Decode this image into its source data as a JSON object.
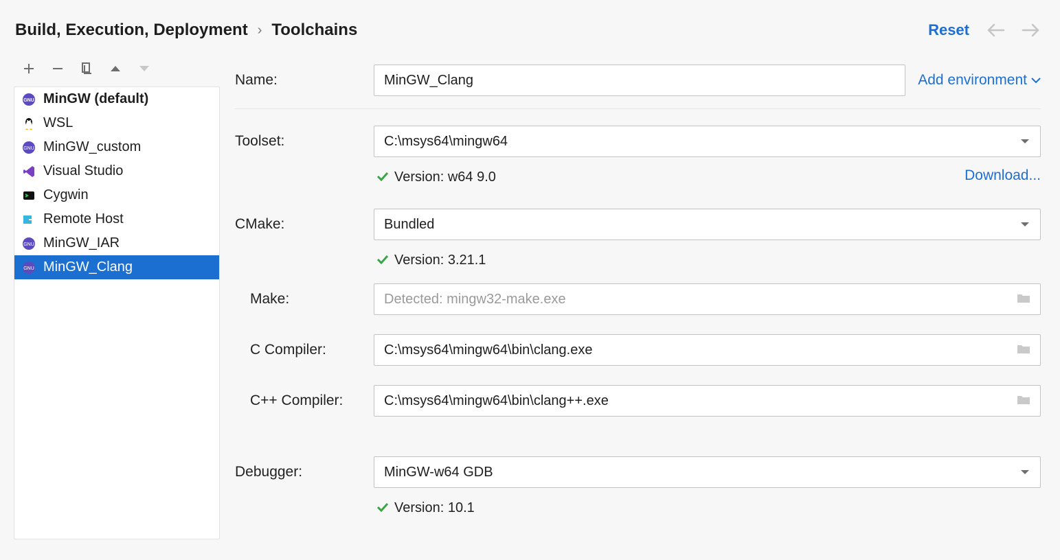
{
  "breadcrumb": {
    "parent": "Build, Execution, Deployment",
    "current": "Toolchains"
  },
  "header": {
    "reset": "Reset"
  },
  "sidebar": {
    "items": [
      {
        "label": "MinGW (default)",
        "icon": "gnu",
        "default": true
      },
      {
        "label": "WSL",
        "icon": "tux"
      },
      {
        "label": "MinGW_custom",
        "icon": "gnu"
      },
      {
        "label": "Visual Studio",
        "icon": "vs"
      },
      {
        "label": "Cygwin",
        "icon": "cygwin"
      },
      {
        "label": "Remote Host",
        "icon": "remote"
      },
      {
        "label": "MinGW_IAR",
        "icon": "gnu"
      },
      {
        "label": "MinGW_Clang",
        "icon": "gnu",
        "selected": true
      }
    ]
  },
  "details": {
    "name_label": "Name:",
    "name_value": "MinGW_Clang",
    "add_env": "Add environment",
    "toolset_label": "Toolset:",
    "toolset_value": "C:\\msys64\\mingw64",
    "toolset_version": "Version: w64 9.0",
    "download": "Download...",
    "cmake_label": "CMake:",
    "cmake_value": "Bundled",
    "cmake_version": "Version: 3.21.1",
    "make_label": "Make:",
    "make_placeholder": "Detected: mingw32-make.exe",
    "ccomp_label": "C Compiler:",
    "ccomp_value": "C:\\msys64\\mingw64\\bin\\clang.exe",
    "cxxcomp_label": "C++ Compiler:",
    "cxxcomp_value": "C:\\msys64\\mingw64\\bin\\clang++.exe",
    "debugger_label": "Debugger:",
    "debugger_value": "MinGW-w64 GDB",
    "debugger_version": "Version: 10.1"
  }
}
